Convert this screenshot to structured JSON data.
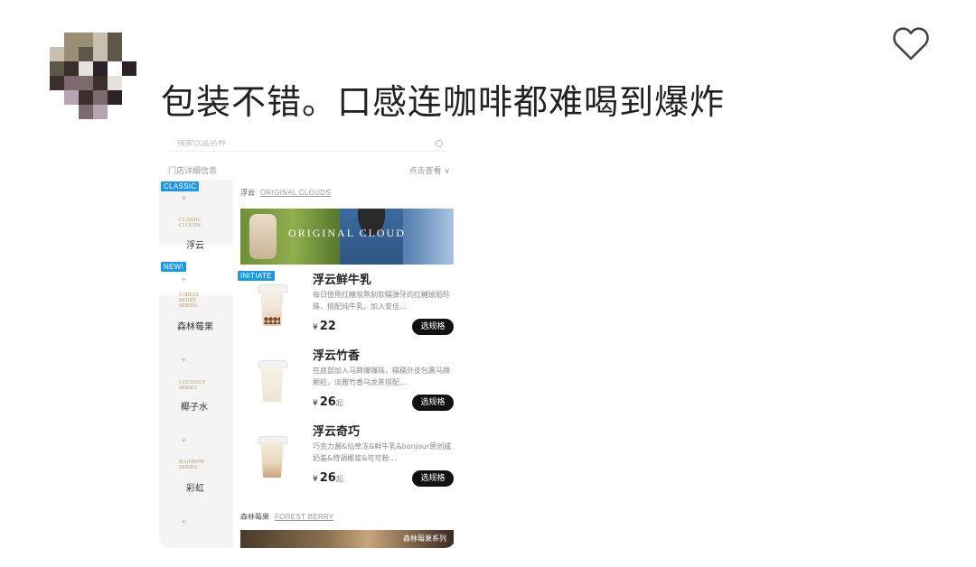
{
  "comment": {
    "text": "包装不错。口感连咖啡都难喝到爆炸"
  },
  "colors": {
    "accent_blue": "#2296e0",
    "button_black": "#111111",
    "avatar_palette": [
      "#c9bfae",
      "#9a8f74",
      "#5e5648",
      "#3b2f2c",
      "#7d6a6e",
      "#b7a4b2",
      "#e6e1dc",
      "#2c2228"
    ]
  },
  "icons": {
    "like": "heart-outline-icon"
  },
  "screenshot": {
    "search_placeholder": "搜索饮品名称",
    "store_info": "门店详细信息",
    "view_more": "点击查看 ∨",
    "sidebar": [
      {
        "badge": "CLASSIC",
        "en": "CLASSIC CLOUDS",
        "label": "浮云"
      },
      {
        "badge": "NEW!",
        "en": "FOREST BERRY SERIES",
        "label": "森林莓果"
      },
      {
        "badge": "",
        "en": "COCONUT SERIES",
        "label": "椰子水"
      },
      {
        "badge": "",
        "en": "RAINBOW SERIES",
        "label": "彩虹"
      }
    ],
    "section1": {
      "cn": "浮云",
      "en": "ORIGINAL CLOUDS",
      "banner": "ORIGINAL CLOUD"
    },
    "initiate_badge": "INITIATE",
    "products": [
      {
        "name": "浮云鲜牛乳",
        "desc": "每日使用红糖炭熬制软糯弹牙的红糖琥珀珍珠，搭配纯牛乳。加入安佳…",
        "yen": "¥",
        "price": "22",
        "suffix": "",
        "button": "选规格"
      },
      {
        "name": "浮云竹香",
        "desc": "在底部加入马蹄爆爆珠，糯糯外皮包裹马蹄颗粒，淡雅竹香乌龙茶搭配…",
        "yen": "¥",
        "price": "26",
        "suffix": "起",
        "button": "选规格"
      },
      {
        "name": "浮云奇巧",
        "desc": "巧克力酱&仙草冻&鲜牛乳&bonjour原创咸奶盖&特调椰浆&可可粉…",
        "yen": "¥",
        "price": "26",
        "suffix": "起",
        "button": "选规格"
      }
    ],
    "section2": {
      "cn": "森林莓果",
      "en": "FOREST BERRY",
      "banner": "森林莓果系列"
    }
  }
}
